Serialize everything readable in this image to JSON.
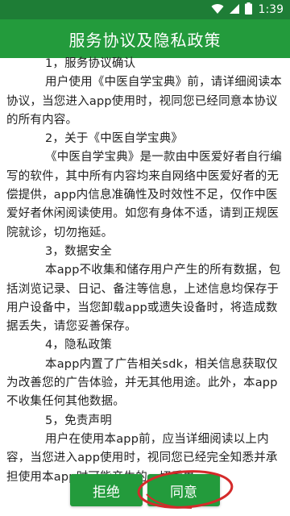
{
  "status_bar": {
    "time": "1:39",
    "icons": [
      "wifi-icon",
      "cellular-signal-icon",
      "battery-icon"
    ]
  },
  "app_bar": {
    "title": "服务协议及隐私政策"
  },
  "sections": [
    {
      "title": "1，服务协议确认",
      "body": "用户使用《中医自学宝典》前，请详细阅读本协议，当您进入app使用时，视同您已经同意本协议的所有内容。"
    },
    {
      "title": "2，关于《中医自学宝典》",
      "body": "《中医自学宝典》是一款由中医爱好者自行编写的软件，其中所有内容均来自网络中医爱好者的无偿提供，app内信息准确性及时效性不足，仅作中医爱好者休闲阅读使用。如您有身体不适，请到正规医院就诊，切勿拖延。"
    },
    {
      "title": "3，数据安全",
      "body": "本app不收集和储存用户产生的所有数据，包括浏览记录、日记、备注等信息，上述信息均保存于用户设备中，当您卸载app或遗失设备时，将造成数据丢失，请您妥善保存。"
    },
    {
      "title": "4，隐私政策",
      "body": "本app内置了广告相关sdk，相关信息获取仅为改善您的广告体验，并无其他用途。此外，本app不收集任何其他数据。"
    },
    {
      "title": "5，免责声明",
      "body": "用户在使用本app前，应当详细阅读以上内容，当您进入app使用时，视同您已经完全知悉并承担使用本app时可能产生的一切后果。"
    }
  ],
  "buttons": {
    "reject_label": "拒绝",
    "agree_label": "同意"
  },
  "colors": {
    "status_bar": "#1e7d36",
    "app_bar": "#239b3c",
    "button": "#239b3c",
    "highlight_ring": "#d42a2a"
  }
}
